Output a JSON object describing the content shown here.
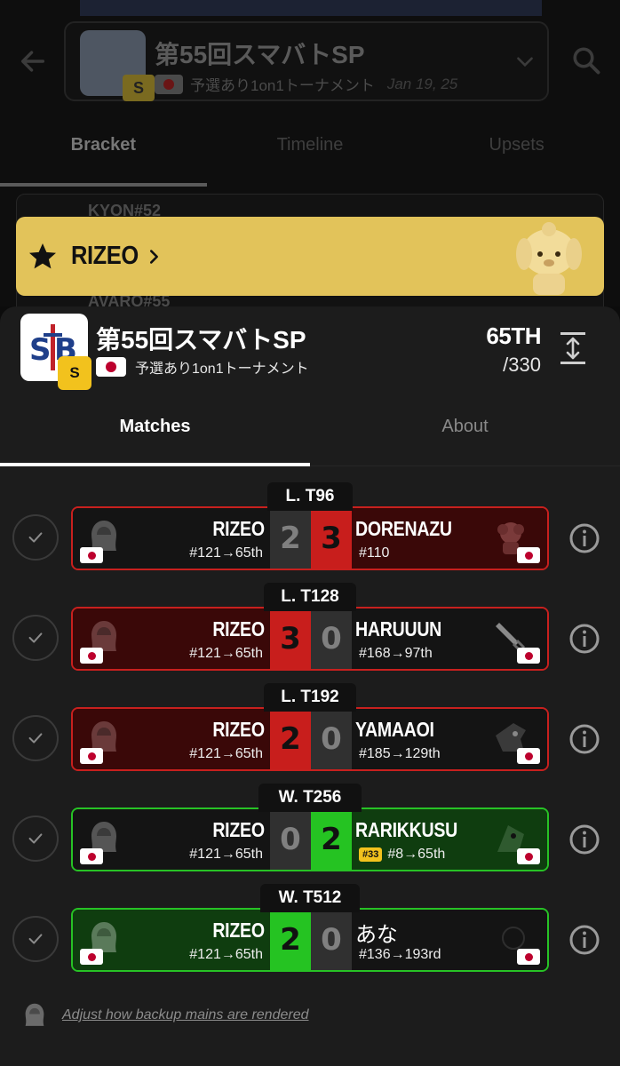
{
  "event": {
    "title": "第55回スマバトSP",
    "tier": "S",
    "description": "予選あり1on1トーナメント",
    "date": "Jan 19, 25"
  },
  "background_tabs": [
    {
      "label": "Bracket",
      "active": true
    },
    {
      "label": "Timeline",
      "active": false
    },
    {
      "label": "Upsets",
      "active": false
    }
  ],
  "background_rows": [
    {
      "label": "KYON#52"
    },
    {
      "label": "AVARO#55"
    }
  ],
  "player": {
    "name": "RIZEO",
    "placement": "65TH",
    "total": "/330",
    "accent_color": "#e2c35a"
  },
  "sheet_tabs": [
    {
      "label": "Matches",
      "active": true
    },
    {
      "label": "About",
      "active": false
    }
  ],
  "matches": [
    {
      "round": "L. T96",
      "result": "loss",
      "left": {
        "name": "RIZEO",
        "seed": "#121→65th",
        "character_icon": "hooded-figure-icon"
      },
      "right": {
        "name": "DORENAZU",
        "seed": "#110",
        "character_icon": "curly-hair-character-icon",
        "badge": ""
      },
      "score_left": "2",
      "score_right": "3"
    },
    {
      "round": "L. T128",
      "result": "win",
      "left": {
        "name": "RIZEO",
        "seed": "#121→65th",
        "character_icon": "hooded-figure-icon"
      },
      "right": {
        "name": "HARUUUN",
        "seed": "#168→97th",
        "character_icon": "sword-icon",
        "badge": ""
      },
      "score_left": "3",
      "score_right": "0"
    },
    {
      "round": "L. T192",
      "result": "win",
      "left": {
        "name": "RIZEO",
        "seed": "#121→65th",
        "character_icon": "hooded-figure-icon"
      },
      "right": {
        "name": "YAMAAOI",
        "seed": "#185→129th",
        "character_icon": "bird-mask-icon",
        "badge": ""
      },
      "score_left": "2",
      "score_right": "0"
    },
    {
      "round": "W. T256",
      "result": "loss",
      "left": {
        "name": "RIZEO",
        "seed": "#121→65th",
        "character_icon": "hooded-figure-icon"
      },
      "right": {
        "name": "RARIKKUSU",
        "seed": "#8→65th",
        "character_icon": "plant-creature-icon",
        "badge": "#33"
      },
      "score_left": "0",
      "score_right": "2"
    },
    {
      "round": "W. T512",
      "result": "win",
      "left": {
        "name": "RIZEO",
        "seed": "#121→65th",
        "character_icon": "hooded-figure-icon"
      },
      "right": {
        "name": "あな",
        "seed": "#136→193rd",
        "character_icon": "unknown-character-icon",
        "badge": ""
      },
      "score_left": "2",
      "score_right": "0"
    }
  ],
  "footer": {
    "link_text": "Adjust how backup mains are rendered"
  },
  "colors": {
    "loss_red": "#c8201e",
    "win_green": "#27c225",
    "tier_gold": "#f2c21d"
  }
}
